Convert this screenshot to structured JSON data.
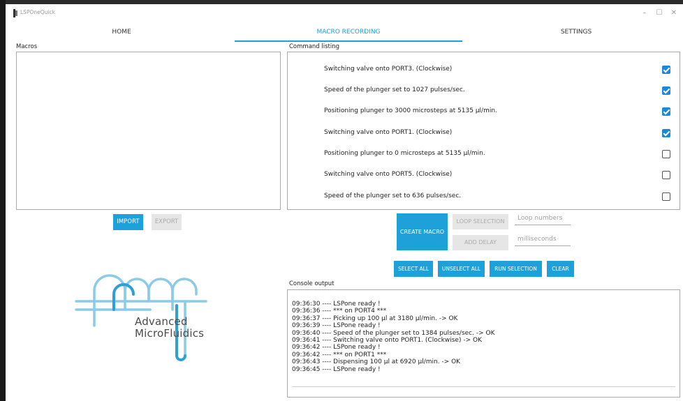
{
  "window": {
    "title": "LSPOneQuick",
    "minimize": "–",
    "maximize": "☐",
    "close": "✕"
  },
  "tabs": [
    {
      "label": "HOME"
    },
    {
      "label": "MACRO RECORDING"
    },
    {
      "label": "SETTINGS"
    }
  ],
  "macros": {
    "label": "Macros",
    "import_label": "IMPORT",
    "export_label": "EXPORT"
  },
  "commands": {
    "label": "Command listing",
    "items": [
      {
        "text": "Switching valve onto PORT3. (Clockwise)",
        "checked": true
      },
      {
        "text": "Speed of the plunger set to 1027 pulses/sec.",
        "checked": true
      },
      {
        "text": "Positioning plunger to 3000 microsteps at 5135 µl/min.",
        "checked": true
      },
      {
        "text": "Switching valve onto PORT1. (Clockwise)",
        "checked": true
      },
      {
        "text": "Positioning plunger to 0 microsteps at 5135 µl/min.",
        "checked": false
      },
      {
        "text": "Switching valve onto PORT5. (Clockwise)",
        "checked": false
      },
      {
        "text": "Speed of the plunger set to 636 pulses/sec.",
        "checked": false
      }
    ]
  },
  "controls": {
    "create_macro": "CREATE MACRO",
    "loop_selection": "LOOP SELECTION",
    "add_delay": "ADD DELAY",
    "loop_numbers_placeholder": "Loop numbers",
    "milliseconds_placeholder": "milliseconds",
    "select_all": "SELECT ALL",
    "unselect_all": "UNSELECT ALL",
    "run_selection": "RUN SELECTION",
    "clear": "CLEAR"
  },
  "console": {
    "label": "Console output",
    "lines": [
      "09:36:30 ---- LSPone ready !",
      "09:36:36 ---- *** on PORT4 ***",
      "09:36:37 ---- Picking up 100 µl at 3180 µl/min. -> OK",
      "09:36:39 ---- LSPone ready !",
      "09:36:40 ---- Speed of the plunger set to 1384 pulses/sec. -> OK",
      "09:36:41 ---- Switching valve onto PORT1. (Clockwise) -> OK",
      "09:36:42 ---- LSPone ready !",
      "09:36:42 ---- *** on PORT1 ***",
      "09:36:43 ---- Dispensing 100 µl at 6920 µl/min. -> OK",
      "09:36:45 ---- LSPone ready !"
    ]
  },
  "logo": {
    "line1": "Advanced",
    "line2": "MicroFluidics"
  },
  "colors": {
    "accent": "#1ea0d8",
    "checkbox": "#1e88d8",
    "disabled_bg": "#e6e6e6",
    "disabled_text": "#aaaaaa"
  }
}
